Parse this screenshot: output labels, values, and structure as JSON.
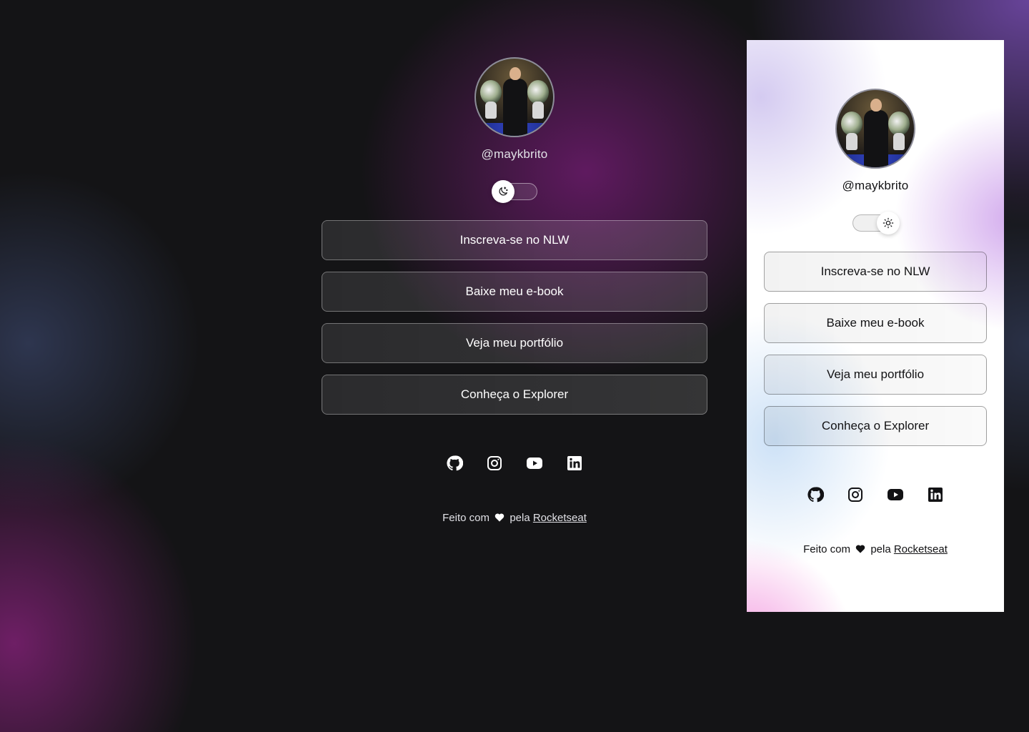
{
  "colors": {
    "background": "#141416",
    "accent_purple": "#7a1e7a",
    "text_light": "#ffffff",
    "text_dark": "#121214"
  },
  "dark_preview": {
    "avatar_icon": "profile-photo",
    "username": "@maykbrito",
    "theme_toggle_state": "dark",
    "theme_toggle_icon": "moon-icon",
    "links": [
      {
        "label": "Inscreva-se no NLW"
      },
      {
        "label": "Baixe meu e-book"
      },
      {
        "label": "Veja meu portfólio"
      },
      {
        "label": "Conheça o Explorer"
      }
    ],
    "social_icons": [
      "github-icon",
      "instagram-icon",
      "youtube-icon",
      "linkedin-icon"
    ],
    "footer": {
      "before_heart": "Feito com",
      "after_heart": "pela",
      "link": "Rocketseat"
    }
  },
  "light_preview": {
    "avatar_icon": "profile-photo",
    "username": "@maykbrito",
    "theme_toggle_state": "light",
    "theme_toggle_icon": "sun-icon",
    "links": [
      {
        "label": "Inscreva-se no NLW"
      },
      {
        "label": "Baixe meu e-book"
      },
      {
        "label": "Veja meu portfólio"
      },
      {
        "label": "Conheça o Explorer"
      }
    ],
    "social_icons": [
      "github-icon",
      "instagram-icon",
      "youtube-icon",
      "linkedin-icon"
    ],
    "footer": {
      "before_heart": "Feito com",
      "after_heart": "pela",
      "link": "Rocketseat"
    }
  }
}
